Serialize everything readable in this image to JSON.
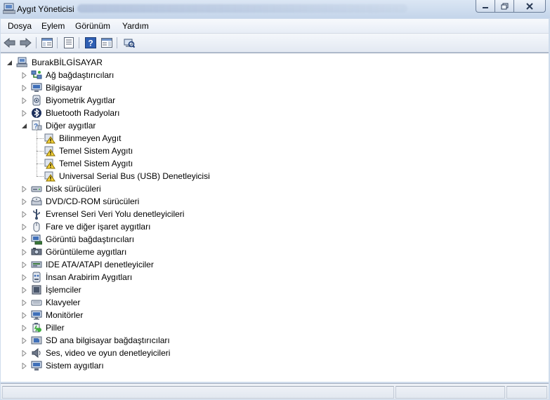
{
  "window": {
    "title": "Aygıt Yöneticisi"
  },
  "menu": [
    "Dosya",
    "Eylem",
    "Görünüm",
    "Yardım"
  ],
  "toolbar": {
    "buttons": [
      {
        "name": "back-button",
        "icon": "arrow-left-icon"
      },
      {
        "name": "forward-button",
        "icon": "arrow-right-icon"
      },
      {
        "name": "show-hide-console-tree-button",
        "icon": "console-tree-icon"
      },
      {
        "name": "properties-button",
        "icon": "properties-icon"
      },
      {
        "name": "help-button",
        "icon": "help-icon"
      },
      {
        "name": "action-pane-button",
        "icon": "action-pane-icon"
      },
      {
        "name": "scan-hardware-button",
        "icon": "scan-hardware-icon"
      }
    ]
  },
  "tree": {
    "root": "BurakBİLGİSAYAR",
    "categories": [
      {
        "label": "Ağ bağdaştırıcıları",
        "icon": "network-adapter-icon",
        "expanded": false
      },
      {
        "label": "Bilgisayar",
        "icon": "computer-icon",
        "expanded": false
      },
      {
        "label": "Biyometrik Aygıtlar",
        "icon": "fingerprint-icon",
        "expanded": false
      },
      {
        "label": "Bluetooth Radyoları",
        "icon": "bluetooth-icon",
        "expanded": false
      },
      {
        "label": "Diğer aygıtlar",
        "icon": "unknown-device-icon",
        "expanded": true,
        "children": [
          {
            "label": "Bilinmeyen Aygıt",
            "icon": "warning-device-icon"
          },
          {
            "label": "Temel Sistem Aygıtı",
            "icon": "warning-device-icon"
          },
          {
            "label": "Temel Sistem Aygıtı",
            "icon": "warning-device-icon"
          },
          {
            "label": "Universal Serial Bus (USB) Denetleyicisi",
            "icon": "warning-device-icon"
          }
        ]
      },
      {
        "label": "Disk sürücüleri",
        "icon": "disk-drive-icon",
        "expanded": false
      },
      {
        "label": "DVD/CD-ROM sürücüleri",
        "icon": "dvd-drive-icon",
        "expanded": false
      },
      {
        "label": "Evrensel Seri Veri Yolu denetleyicileri",
        "icon": "usb-controller-icon",
        "expanded": false
      },
      {
        "label": "Fare ve diğer işaret aygıtları",
        "icon": "mouse-icon",
        "expanded": false
      },
      {
        "label": "Görüntü bağdaştırıcıları",
        "icon": "display-adapter-icon",
        "expanded": false
      },
      {
        "label": "Görüntüleme aygıtları",
        "icon": "imaging-device-icon",
        "expanded": false
      },
      {
        "label": "IDE ATA/ATAPI denetleyiciler",
        "icon": "ide-controller-icon",
        "expanded": false
      },
      {
        "label": "İnsan Arabirim Aygıtları",
        "icon": "hid-icon",
        "expanded": false
      },
      {
        "label": "İşlemciler",
        "icon": "processor-icon",
        "expanded": false
      },
      {
        "label": "Klavyeler",
        "icon": "keyboard-icon",
        "expanded": false
      },
      {
        "label": "Monitörler",
        "icon": "monitor-icon",
        "expanded": false
      },
      {
        "label": "Piller",
        "icon": "battery-icon",
        "expanded": false
      },
      {
        "label": "SD ana bilgisayar bağdaştırıcıları",
        "icon": "sd-host-icon",
        "expanded": false
      },
      {
        "label": "Ses, video ve oyun denetleyicileri",
        "icon": "speaker-icon",
        "expanded": false
      },
      {
        "label": "Sistem aygıtları",
        "icon": "system-device-icon",
        "expanded": false
      }
    ]
  }
}
